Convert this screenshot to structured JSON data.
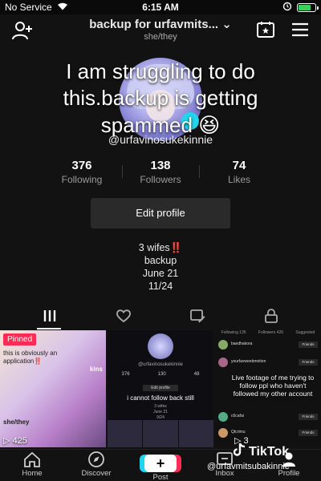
{
  "status_bar": {
    "carrier": "No Service",
    "time": "6:15 AM"
  },
  "header": {
    "title": "backup for urfavmits...",
    "pronouns": "she/they"
  },
  "overlay_text": {
    "line1": "I am struggling to do",
    "line2": "this.backup is getting",
    "line3": "spammed",
    "emoji": "😆"
  },
  "profile": {
    "handle": "@urfavinosukekinnie",
    "stats": [
      {
        "value": "376",
        "label": "Following"
      },
      {
        "value": "138",
        "label": "Followers"
      },
      {
        "value": "74",
        "label": "Likes"
      }
    ],
    "edit_label": "Edit profile",
    "bio": [
      "3 wifes‼️",
      "backup",
      "June 21",
      "11/24"
    ]
  },
  "tabs": [
    {
      "icon": "grid-icon"
    },
    {
      "icon": "heart-icon"
    },
    {
      "icon": "tagged-icon"
    },
    {
      "icon": "lock-icon"
    }
  ],
  "videos": [
    {
      "badge": "Pinned",
      "views": "425",
      "text": [
        "this is obviously an",
        "application‼️",
        "kins",
        "she/they"
      ]
    },
    {
      "handle": "@urfavinosukekinnie",
      "stats": [
        "376",
        "130",
        "48"
      ],
      "button": "Edit profile",
      "caption": "i cannot follow back still",
      "bio": [
        "3 wifes",
        "June 21",
        "9/24"
      ]
    },
    {
      "caption": "Live footage of me trying to follow ppl who haven't followed my other account",
      "views": "3",
      "tab_labels": [
        "Following 135",
        "Followers 426",
        "Suggested"
      ],
      "rows": [
        {
          "name": "baedhakora",
          "button": "Friends"
        },
        {
          "name": "yourfavweebmotion",
          "button": "Friends"
        },
        {
          "name": "c6cafai",
          "button": "Friends"
        },
        {
          "name": "Qtcrimu",
          "button": "Friends"
        }
      ]
    }
  ],
  "watermark": {
    "brand": "TikTok",
    "handle": "@urfavmitsubakinnie"
  },
  "bottom_nav": {
    "home": "Home",
    "discover": "Discover",
    "post": "Post",
    "inbox": "Inbox",
    "profile": "Profile",
    "post_symbol": "+"
  },
  "colors": {
    "background": "#121212",
    "accent_red": "#fe2c55",
    "accent_cyan": "#20d5ec",
    "battery_green": "#3ad15a"
  }
}
